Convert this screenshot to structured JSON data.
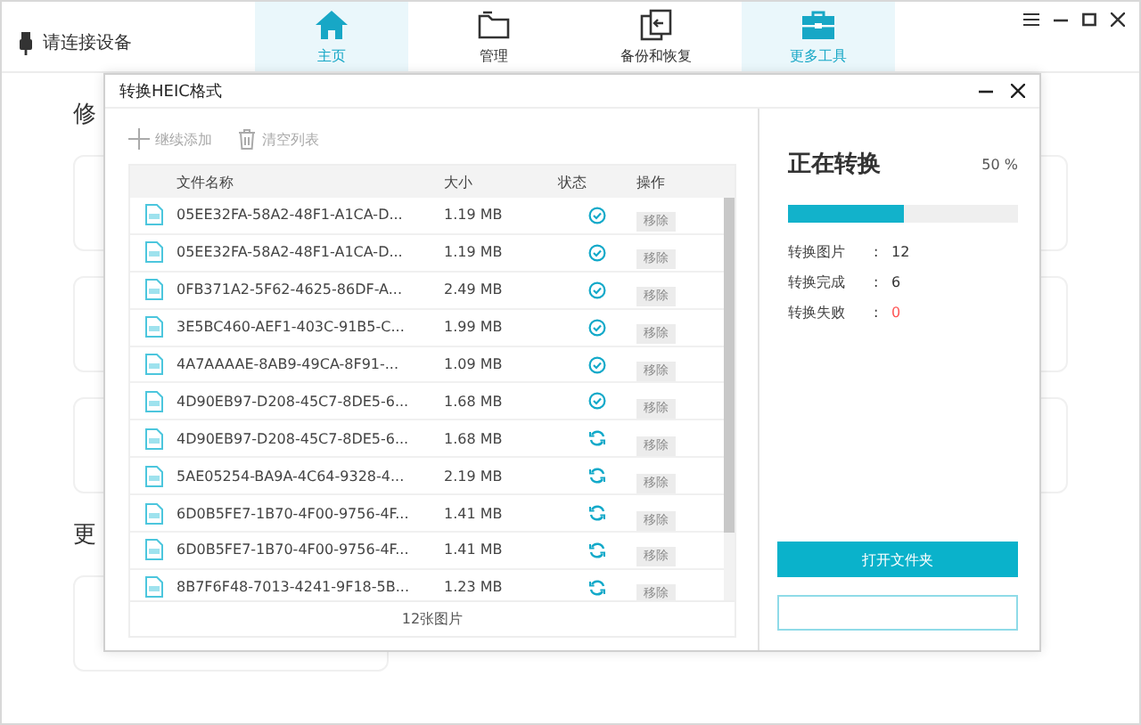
{
  "device": {
    "label": "请连接设备"
  },
  "tabs": [
    {
      "label": "主页",
      "selected": true
    },
    {
      "label": "管理",
      "selected": false
    },
    {
      "label": "备份和恢复",
      "selected": false
    },
    {
      "label": "更多工具",
      "selected": true
    }
  ],
  "background": {
    "section_1": "修",
    "section_2": "更"
  },
  "dialog": {
    "title": "转换HEIC格式",
    "toolbar": [
      "继续添加",
      "清空列表"
    ],
    "columns": [
      "文件名称",
      "大小",
      "状态",
      "操作"
    ],
    "rows": [
      {
        "name": "05EE32FA-58A2-48F1-A1CA-D...",
        "size": "1.19 MB",
        "kind": "done",
        "action": "移除"
      },
      {
        "name": "05EE32FA-58A2-48F1-A1CA-D...",
        "size": "1.19 MB",
        "kind": "done",
        "action": "移除"
      },
      {
        "name": "0FB371A2-5F62-4625-86DF-A...",
        "size": "2.49 MB",
        "kind": "done",
        "action": "移除"
      },
      {
        "name": "3E5BC460-AEF1-403C-91B5-C...",
        "size": "1.99 MB",
        "kind": "done",
        "action": "移除"
      },
      {
        "name": "4A7AAAAE-8AB9-49CA-8F91-...",
        "size": "1.09 MB",
        "kind": "done",
        "action": "移除"
      },
      {
        "name": "4D90EB97-D208-45C7-8DE5-6...",
        "size": "1.68 MB",
        "kind": "done",
        "action": "移除"
      },
      {
        "name": "4D90EB97-D208-45C7-8DE5-6...",
        "size": "1.68 MB",
        "kind": "converting",
        "action": "移除"
      },
      {
        "name": "5AE05254-BA9A-4C64-9328-4...",
        "size": "2.19 MB",
        "kind": "converting",
        "action": "移除"
      },
      {
        "name": "6D0B5FE7-1B70-4F00-9756-4F...",
        "size": "1.41 MB",
        "kind": "converting",
        "action": "移除"
      },
      {
        "name": "6D0B5FE7-1B70-4F00-9756-4F...",
        "size": "1.41 MB",
        "kind": "converting",
        "action": "移除"
      },
      {
        "name": "8B7F6F48-7013-4241-9F18-5B...",
        "size": "1.23 MB",
        "kind": "converting",
        "action": "移除"
      }
    ],
    "footer": "12张图片",
    "progress": {
      "title": "正在转换",
      "percent": "50 %",
      "level": 0.5
    },
    "stats": [
      {
        "label": "转换图片",
        "separator": ":",
        "value": "12",
        "kind": "normal"
      },
      {
        "label": "转换完成",
        "separator": ":",
        "value": "6",
        "kind": "normal"
      },
      {
        "label": "转换失败",
        "separator": ":",
        "value": "0",
        "kind": "error"
      }
    ],
    "primary_button": "打开文件夹"
  }
}
